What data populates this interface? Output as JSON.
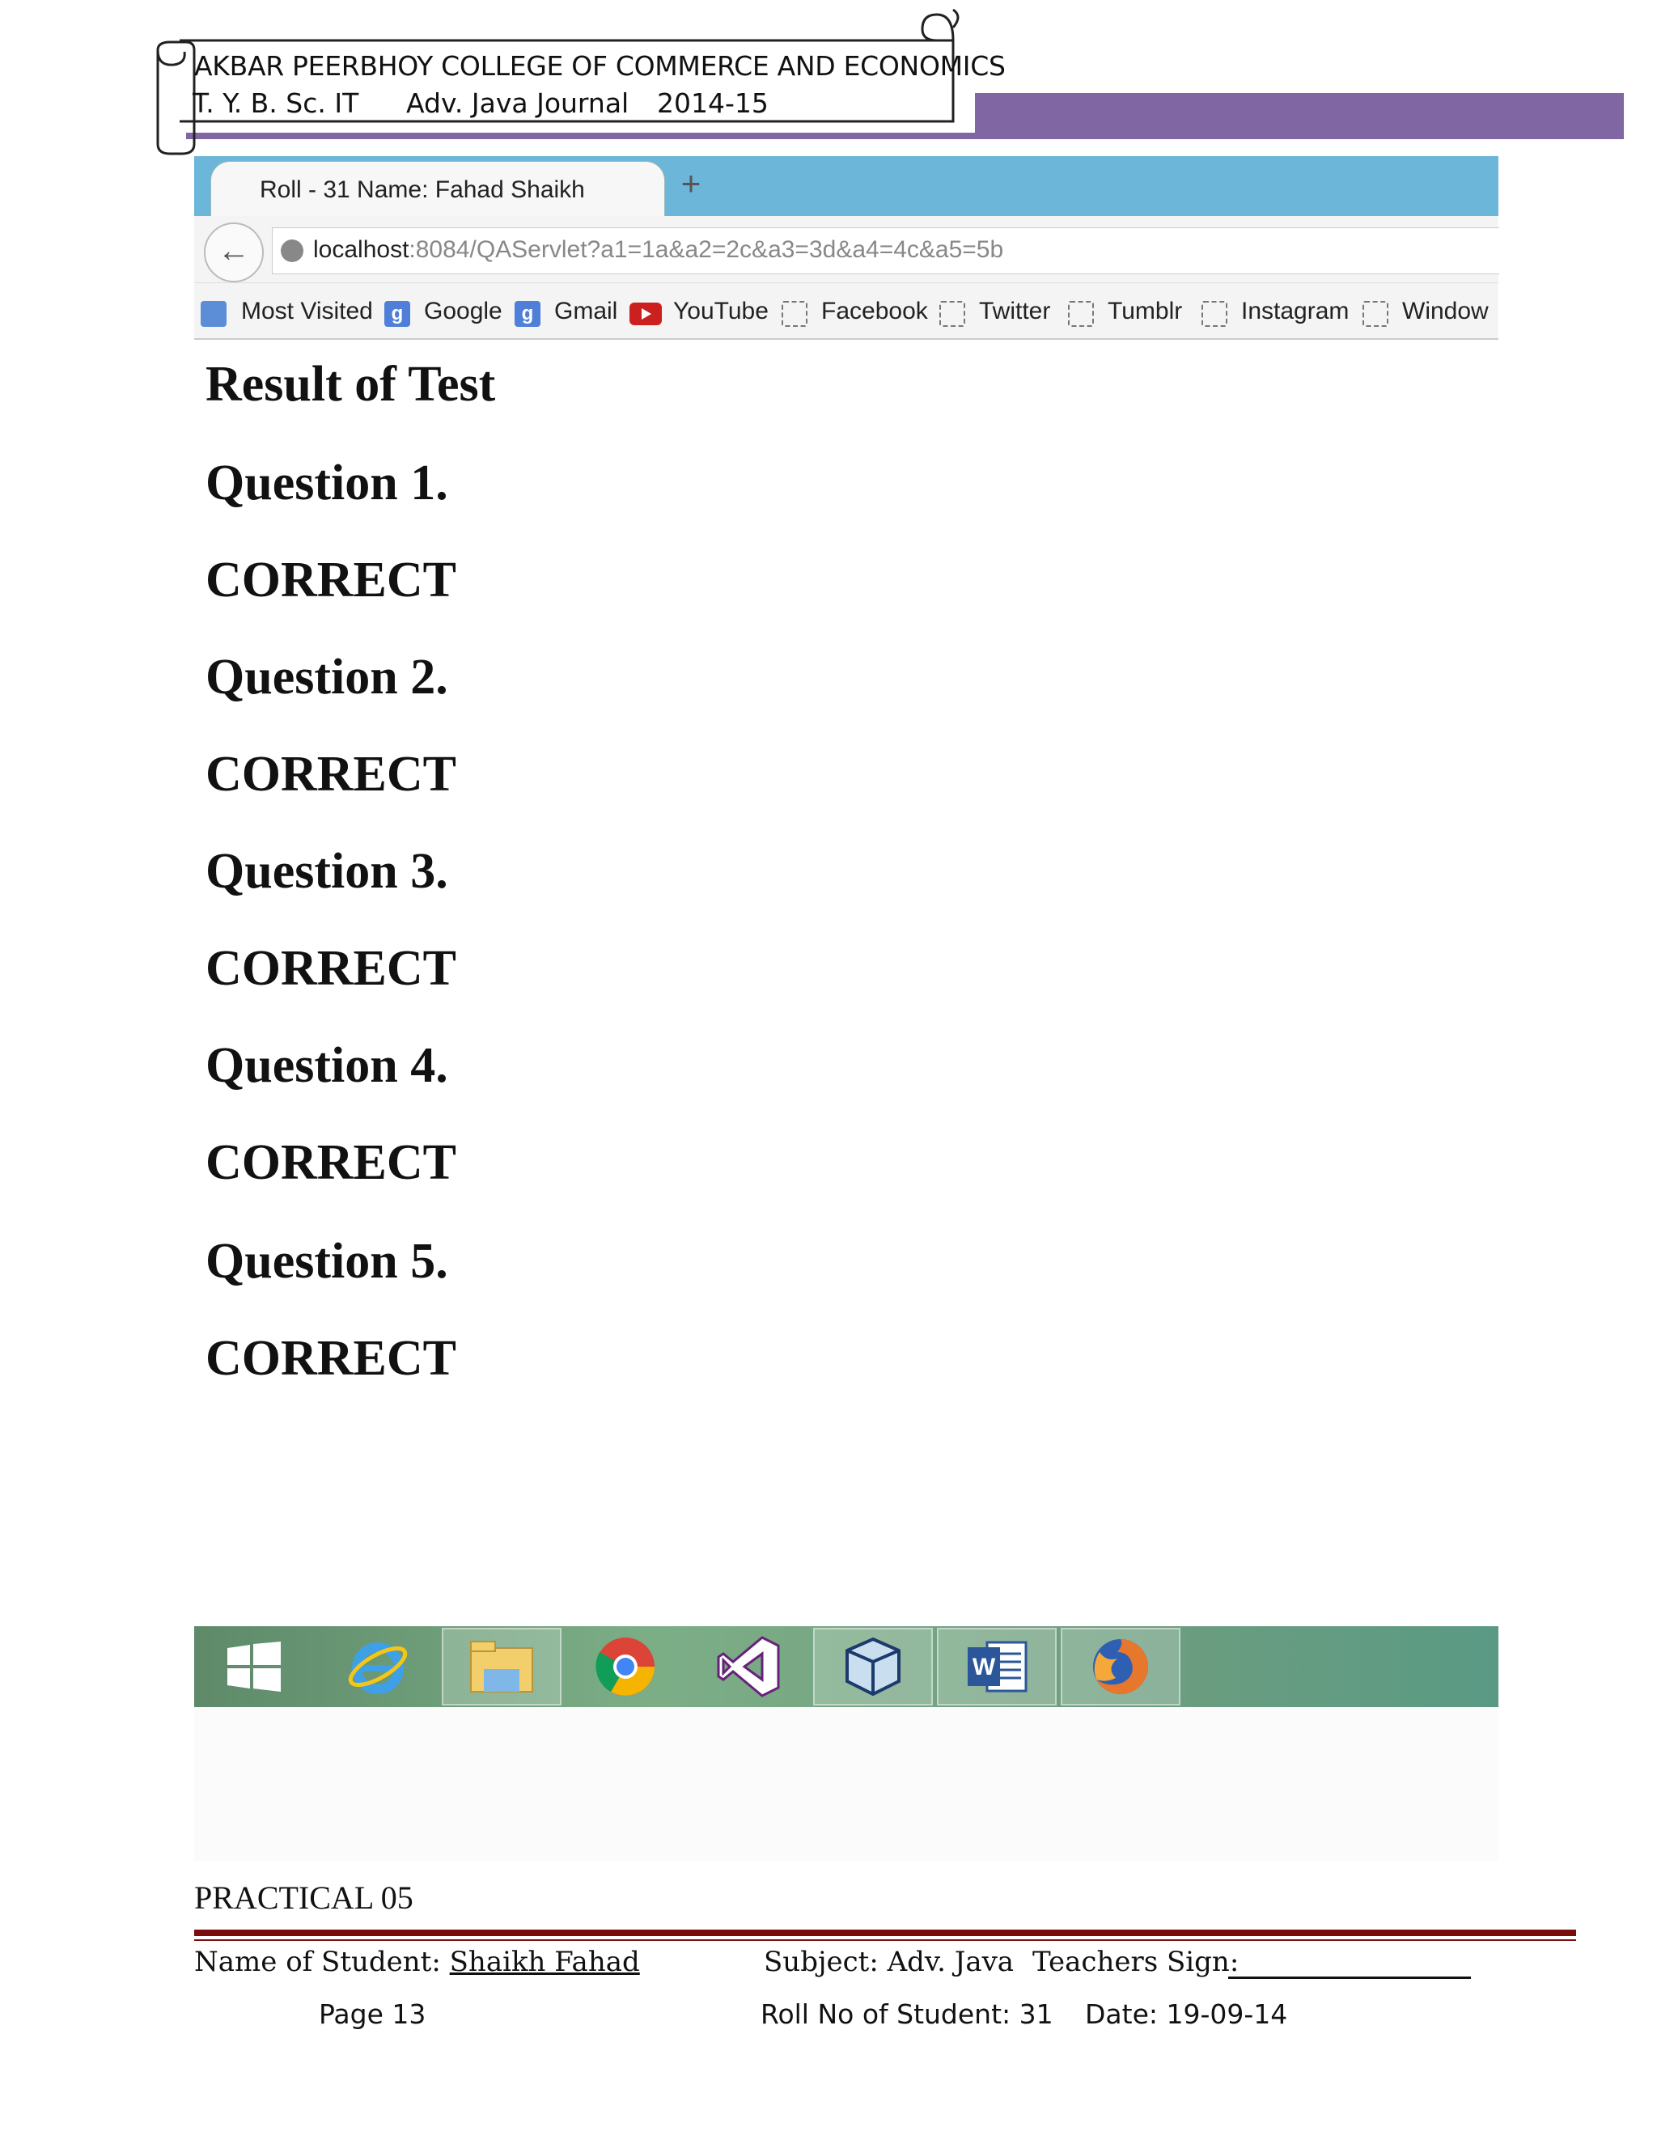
{
  "journal_header": {
    "college": "AKBAR PEERBHOY COLLEGE OF COMMERCE AND ECONOMICS",
    "class": "T. Y. B. Sc. IT",
    "journal": "Adv. Java Journal",
    "year": "2014-15",
    "accent_color": "#8066a3"
  },
  "browser": {
    "tab_title": "Roll - 31 Name: Fahad Shaikh",
    "new_tab_label": "+",
    "url_host": "localhost",
    "url_rest": ":8084/QAServlet?a1=1a&a2=2c&a3=3d&a4=4c&a5=5b",
    "bookmarks": [
      {
        "label": "Most Visited",
        "icon": "most-visited-icon"
      },
      {
        "label": "Google",
        "icon": "google-icon"
      },
      {
        "label": "Gmail",
        "icon": "gmail-icon"
      },
      {
        "label": "YouTube",
        "icon": "youtube-icon"
      },
      {
        "label": "Facebook",
        "icon": "blank-page-icon"
      },
      {
        "label": "Twitter",
        "icon": "blank-page-icon"
      },
      {
        "label": "Tumblr",
        "icon": "blank-page-icon"
      },
      {
        "label": "Instagram",
        "icon": "blank-page-icon"
      },
      {
        "label": "Window",
        "icon": "blank-page-icon"
      }
    ]
  },
  "page": {
    "title": "Result of Test",
    "results": [
      {
        "question": "Question 1.",
        "verdict": "CORRECT"
      },
      {
        "question": "Question 2.",
        "verdict": "CORRECT"
      },
      {
        "question": "Question 3.",
        "verdict": "CORRECT"
      },
      {
        "question": "Question 4.",
        "verdict": "CORRECT"
      },
      {
        "question": "Question 5.",
        "verdict": "CORRECT"
      }
    ]
  },
  "taskbar": {
    "items": [
      "windows-start-icon",
      "internet-explorer-icon",
      "file-explorer-icon",
      "chrome-icon",
      "visual-studio-icon",
      "virtualbox-icon",
      "word-icon",
      "firefox-icon"
    ]
  },
  "footer": {
    "practical": "PRACTICAL 05",
    "name_label": "Name of Student:",
    "name_value": "Shaikh Fahad",
    "subject": "Subject: Adv. Java",
    "teacher_sign": "Teachers Sign:",
    "page": "Page 13",
    "roll_no": "Roll No of Student: 31",
    "date": "Date: 19-09-14",
    "rule_color": "#7b0d0d"
  }
}
